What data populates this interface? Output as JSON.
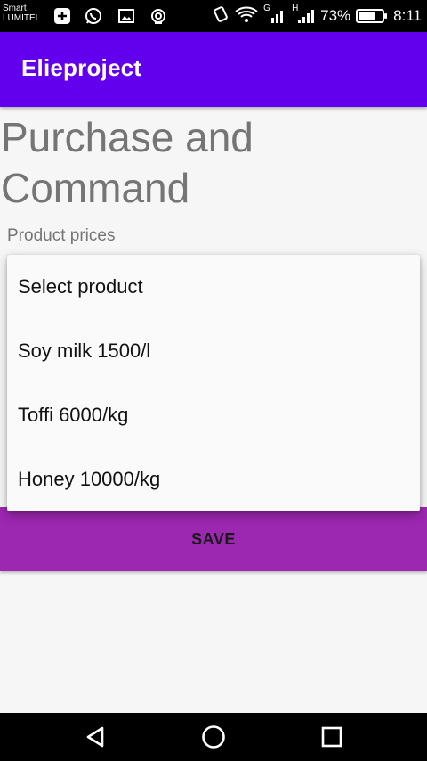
{
  "status_bar": {
    "carrier_line1": "Smart",
    "carrier_line2": "LUMITEL",
    "battery_percent": "73%",
    "battery_level": 0.73,
    "time": "8:11",
    "network_g": "G",
    "network_h": "H"
  },
  "app_bar": {
    "title": "Elieproject"
  },
  "main": {
    "page_title": "Purchase and Command",
    "section_label": "Product prices",
    "save_label": "SAVE"
  },
  "dropdown": {
    "items": [
      {
        "label": "Select product"
      },
      {
        "label": "Soy milk 1500/l"
      },
      {
        "label": "Toffi 6000/kg"
      },
      {
        "label": "Honey 10000/kg"
      }
    ]
  },
  "colors": {
    "app_bar": "#6200ee",
    "save_button": "#9c27b0",
    "title_text": "#757575"
  }
}
